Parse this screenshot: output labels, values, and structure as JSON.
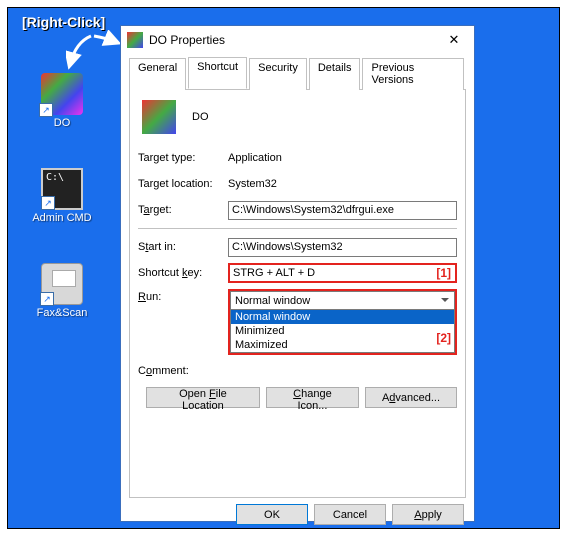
{
  "annotation": "[Right-Click]",
  "desktop_icons": {
    "do": "DO",
    "cmd": "Admin CMD",
    "fax": "Fax&Scan"
  },
  "window": {
    "title": "DO Properties",
    "tabs": [
      "General",
      "Shortcut",
      "Security",
      "Details",
      "Previous Versions"
    ],
    "header_name": "DO",
    "target_type_label": "Target type:",
    "target_type_value": "Application",
    "target_loc_label": "Target location:",
    "target_loc_value": "System32",
    "target_label_pre": "T",
    "target_label_u": "a",
    "target_label_post": "rget:",
    "target_value": "C:\\Windows\\System32\\dfrgui.exe",
    "startin_label_pre": "S",
    "startin_label_u": "t",
    "startin_label_post": "art in:",
    "startin_value": "C:\\Windows\\System32",
    "shortcut_label_pre": "Shortcut ",
    "shortcut_label_u": "k",
    "shortcut_label_post": "ey:",
    "shortcut_value": "STRG + ALT + D",
    "shortcut_tag": "[1]",
    "run_label_u": "R",
    "run_label_post": "un:",
    "run_selected": "Normal window",
    "run_options": [
      "Normal window",
      "Minimized",
      "Maximized"
    ],
    "run_tag": "[2]",
    "comment_label_pre": "C",
    "comment_label_u": "o",
    "comment_label_post": "mment:",
    "btn_file_pre": "Open ",
    "btn_file_u": "F",
    "btn_file_post": "ile Location",
    "btn_icon_u": "C",
    "btn_icon_post": "hange Icon...",
    "btn_adv_pre": "A",
    "btn_adv_u": "d",
    "btn_adv_post": "vanced...",
    "ok": "OK",
    "cancel": "Cancel",
    "apply_u": "A",
    "apply_post": "pply"
  }
}
